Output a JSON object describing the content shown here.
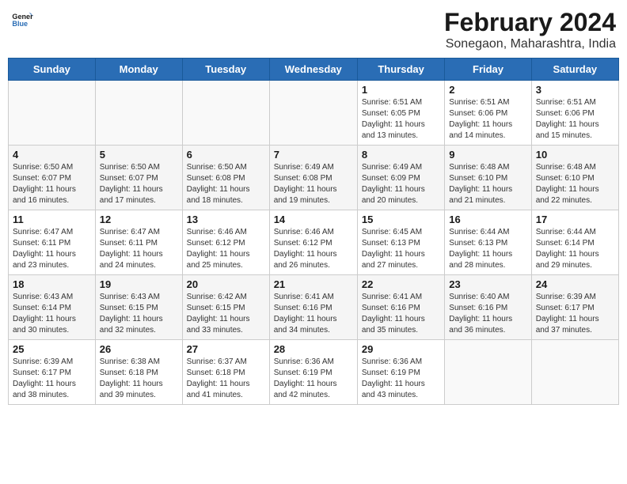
{
  "logo": {
    "line1": "General",
    "line2": "Blue"
  },
  "title": "February 2024",
  "subtitle": "Sonegaon, Maharashtra, India",
  "days_of_week": [
    "Sunday",
    "Monday",
    "Tuesday",
    "Wednesday",
    "Thursday",
    "Friday",
    "Saturday"
  ],
  "weeks": [
    [
      {
        "num": "",
        "info": ""
      },
      {
        "num": "",
        "info": ""
      },
      {
        "num": "",
        "info": ""
      },
      {
        "num": "",
        "info": ""
      },
      {
        "num": "1",
        "info": "Sunrise: 6:51 AM\nSunset: 6:05 PM\nDaylight: 11 hours\nand 13 minutes."
      },
      {
        "num": "2",
        "info": "Sunrise: 6:51 AM\nSunset: 6:06 PM\nDaylight: 11 hours\nand 14 minutes."
      },
      {
        "num": "3",
        "info": "Sunrise: 6:51 AM\nSunset: 6:06 PM\nDaylight: 11 hours\nand 15 minutes."
      }
    ],
    [
      {
        "num": "4",
        "info": "Sunrise: 6:50 AM\nSunset: 6:07 PM\nDaylight: 11 hours\nand 16 minutes."
      },
      {
        "num": "5",
        "info": "Sunrise: 6:50 AM\nSunset: 6:07 PM\nDaylight: 11 hours\nand 17 minutes."
      },
      {
        "num": "6",
        "info": "Sunrise: 6:50 AM\nSunset: 6:08 PM\nDaylight: 11 hours\nand 18 minutes."
      },
      {
        "num": "7",
        "info": "Sunrise: 6:49 AM\nSunset: 6:08 PM\nDaylight: 11 hours\nand 19 minutes."
      },
      {
        "num": "8",
        "info": "Sunrise: 6:49 AM\nSunset: 6:09 PM\nDaylight: 11 hours\nand 20 minutes."
      },
      {
        "num": "9",
        "info": "Sunrise: 6:48 AM\nSunset: 6:10 PM\nDaylight: 11 hours\nand 21 minutes."
      },
      {
        "num": "10",
        "info": "Sunrise: 6:48 AM\nSunset: 6:10 PM\nDaylight: 11 hours\nand 22 minutes."
      }
    ],
    [
      {
        "num": "11",
        "info": "Sunrise: 6:47 AM\nSunset: 6:11 PM\nDaylight: 11 hours\nand 23 minutes."
      },
      {
        "num": "12",
        "info": "Sunrise: 6:47 AM\nSunset: 6:11 PM\nDaylight: 11 hours\nand 24 minutes."
      },
      {
        "num": "13",
        "info": "Sunrise: 6:46 AM\nSunset: 6:12 PM\nDaylight: 11 hours\nand 25 minutes."
      },
      {
        "num": "14",
        "info": "Sunrise: 6:46 AM\nSunset: 6:12 PM\nDaylight: 11 hours\nand 26 minutes."
      },
      {
        "num": "15",
        "info": "Sunrise: 6:45 AM\nSunset: 6:13 PM\nDaylight: 11 hours\nand 27 minutes."
      },
      {
        "num": "16",
        "info": "Sunrise: 6:44 AM\nSunset: 6:13 PM\nDaylight: 11 hours\nand 28 minutes."
      },
      {
        "num": "17",
        "info": "Sunrise: 6:44 AM\nSunset: 6:14 PM\nDaylight: 11 hours\nand 29 minutes."
      }
    ],
    [
      {
        "num": "18",
        "info": "Sunrise: 6:43 AM\nSunset: 6:14 PM\nDaylight: 11 hours\nand 30 minutes."
      },
      {
        "num": "19",
        "info": "Sunrise: 6:43 AM\nSunset: 6:15 PM\nDaylight: 11 hours\nand 32 minutes."
      },
      {
        "num": "20",
        "info": "Sunrise: 6:42 AM\nSunset: 6:15 PM\nDaylight: 11 hours\nand 33 minutes."
      },
      {
        "num": "21",
        "info": "Sunrise: 6:41 AM\nSunset: 6:16 PM\nDaylight: 11 hours\nand 34 minutes."
      },
      {
        "num": "22",
        "info": "Sunrise: 6:41 AM\nSunset: 6:16 PM\nDaylight: 11 hours\nand 35 minutes."
      },
      {
        "num": "23",
        "info": "Sunrise: 6:40 AM\nSunset: 6:16 PM\nDaylight: 11 hours\nand 36 minutes."
      },
      {
        "num": "24",
        "info": "Sunrise: 6:39 AM\nSunset: 6:17 PM\nDaylight: 11 hours\nand 37 minutes."
      }
    ],
    [
      {
        "num": "25",
        "info": "Sunrise: 6:39 AM\nSunset: 6:17 PM\nDaylight: 11 hours\nand 38 minutes."
      },
      {
        "num": "26",
        "info": "Sunrise: 6:38 AM\nSunset: 6:18 PM\nDaylight: 11 hours\nand 39 minutes."
      },
      {
        "num": "27",
        "info": "Sunrise: 6:37 AM\nSunset: 6:18 PM\nDaylight: 11 hours\nand 41 minutes."
      },
      {
        "num": "28",
        "info": "Sunrise: 6:36 AM\nSunset: 6:19 PM\nDaylight: 11 hours\nand 42 minutes."
      },
      {
        "num": "29",
        "info": "Sunrise: 6:36 AM\nSunset: 6:19 PM\nDaylight: 11 hours\nand 43 minutes."
      },
      {
        "num": "",
        "info": ""
      },
      {
        "num": "",
        "info": ""
      }
    ]
  ]
}
